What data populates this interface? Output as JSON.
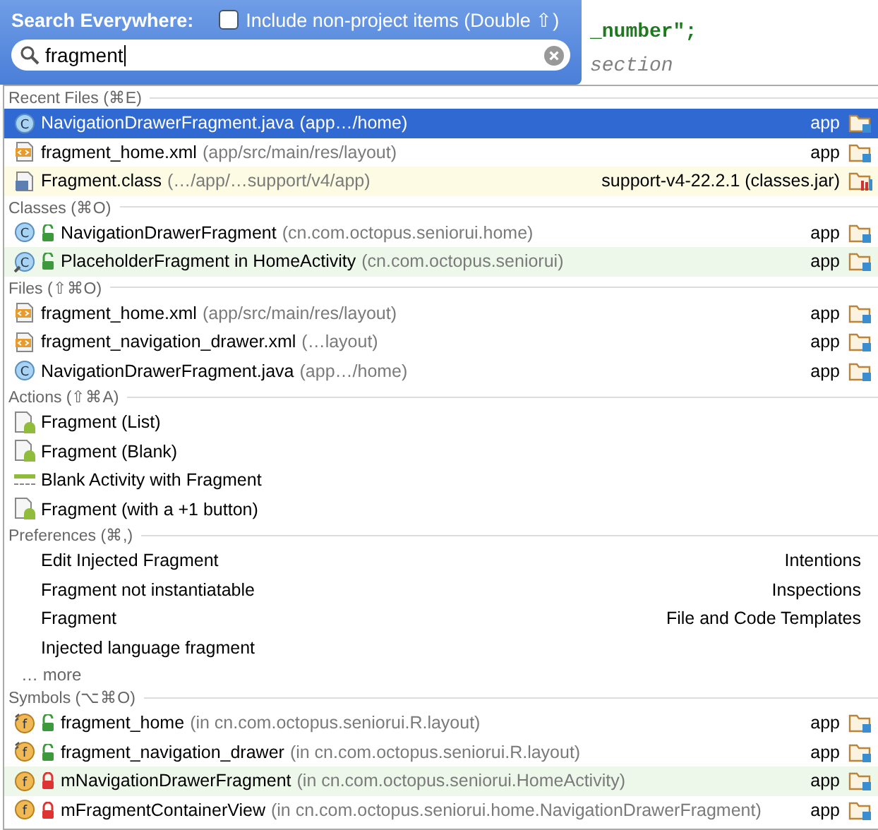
{
  "editor": {
    "lines": [
      {
        "text": "_number\";",
        "kind": "string"
      },
      {
        "text": "section",
        "kind": "comment"
      }
    ]
  },
  "header": {
    "title": "Search Everywhere:",
    "option": {
      "label": "Include non-project items (Double ⇧)",
      "checked": false
    }
  },
  "search": {
    "value": "fragment"
  },
  "sections": [
    {
      "title": "Recent Files (⌘E)",
      "rows": [
        {
          "kind": "class",
          "glyph": "C",
          "name": "NavigationDrawerFragment.java",
          "detail": "(app…/home)",
          "location": {
            "text": "app",
            "kind": "module"
          },
          "selected": true
        },
        {
          "kind": "xml",
          "name": "fragment_home.xml",
          "detail": "(app/src/main/res/layout)",
          "location": {
            "text": "app",
            "kind": "module"
          },
          "selected": false
        },
        {
          "kind": "class-file",
          "name": "Fragment.class",
          "detail": "(…/app/…support/v4/app)",
          "location": {
            "text": "support-v4-22.2.1 (classes.jar)",
            "kind": "library"
          },
          "selected": false,
          "color": "#fdfbe3"
        }
      ]
    },
    {
      "title": "Classes (⌘O)",
      "rows": [
        {
          "kind": "class",
          "glyph": "C",
          "locked": false,
          "name": "NavigationDrawerFragment",
          "detail": "(cn.com.octopus.seniorui.home)",
          "location": {
            "text": "app",
            "kind": "module"
          },
          "selected": false
        },
        {
          "kind": "inner-class",
          "glyph": "C",
          "locked": false,
          "name": "PlaceholderFragment in HomeActivity",
          "detail": "(cn.com.octopus.seniorui)",
          "location": {
            "text": "app",
            "kind": "module"
          },
          "selected": false,
          "color": "#eef8ea"
        }
      ]
    },
    {
      "title": "Files (⇧⌘O)",
      "rows": [
        {
          "kind": "xml",
          "name": "fragment_home.xml",
          "detail": "(app/src/main/res/layout)",
          "location": {
            "text": "app",
            "kind": "module"
          },
          "selected": false
        },
        {
          "kind": "xml",
          "name": "fragment_navigation_drawer.xml",
          "detail": "(…layout)",
          "location": {
            "text": "app",
            "kind": "module"
          },
          "selected": false
        },
        {
          "kind": "class",
          "glyph": "C",
          "name": "NavigationDrawerFragment.java",
          "detail": "(app…/home)",
          "location": {
            "text": "app",
            "kind": "module"
          },
          "selected": false
        }
      ]
    },
    {
      "title": "Actions (⇧⌘A)",
      "rows": [
        {
          "kind": "android",
          "name": "Fragment (List)",
          "selected": false
        },
        {
          "kind": "android",
          "name": "Fragment (Blank)",
          "selected": false
        },
        {
          "kind": "template",
          "name": "Blank Activity with Fragment",
          "selected": false
        },
        {
          "kind": "android",
          "name": "Fragment (with a +1 button)",
          "selected": false
        }
      ]
    },
    {
      "title": "Preferences (⌘,)",
      "rows": [
        {
          "kind": "setting",
          "name": "Edit Injected Fragment",
          "location": {
            "text": "Intentions",
            "kind": "plain"
          },
          "selected": false
        },
        {
          "kind": "setting",
          "name": "Fragment not instantiatable",
          "location": {
            "text": "Inspections",
            "kind": "plain"
          },
          "selected": false
        },
        {
          "kind": "setting",
          "name": "Fragment",
          "location": {
            "text": "File and Code Templates",
            "kind": "plain"
          },
          "selected": false
        },
        {
          "kind": "setting",
          "name": "Injected language fragment",
          "selected": false
        }
      ],
      "more": "… more"
    },
    {
      "title": "Symbols (⌥⌘O)",
      "rows": [
        {
          "kind": "static-field",
          "glyph": "f",
          "locked": false,
          "name": "fragment_home",
          "detail": "(in cn.com.octopus.seniorui.R.layout)",
          "location": {
            "text": "app",
            "kind": "module"
          },
          "selected": false
        },
        {
          "kind": "static-field",
          "glyph": "f",
          "locked": false,
          "name": "fragment_navigation_drawer",
          "detail": "(in cn.com.octopus.seniorui.R.layout)",
          "location": {
            "text": "app",
            "kind": "module"
          },
          "selected": false
        },
        {
          "kind": "field",
          "glyph": "f",
          "locked": true,
          "name": "mNavigationDrawerFragment",
          "detail": "(in cn.com.octopus.seniorui.HomeActivity)",
          "location": {
            "text": "app",
            "kind": "module"
          },
          "selected": false,
          "color": "#eef8ea"
        },
        {
          "kind": "field",
          "glyph": "f",
          "locked": true,
          "name": "mFragmentContainerView",
          "detail": "(in cn.com.octopus.seniorui.home.NavigationDrawerFragment)",
          "location": {
            "text": "app",
            "kind": "module"
          },
          "selected": false
        }
      ]
    }
  ]
}
